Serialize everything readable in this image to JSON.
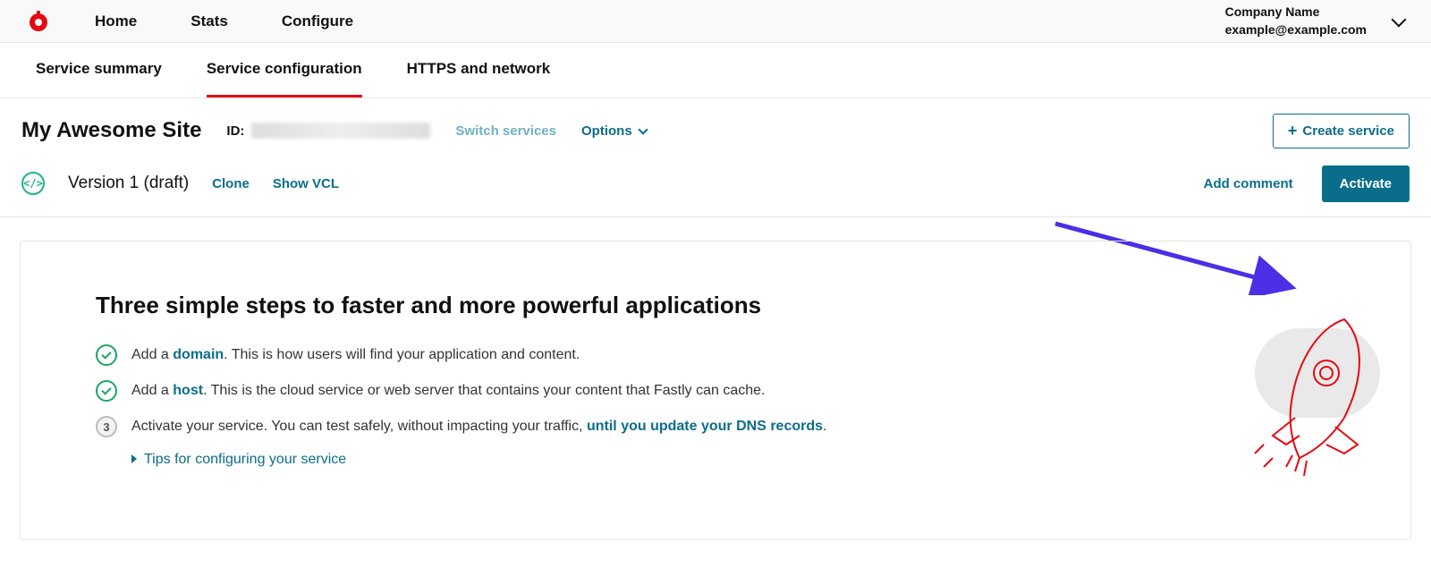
{
  "topnav": {
    "items": [
      "Home",
      "Stats",
      "Configure"
    ],
    "account": {
      "company": "Company Name",
      "email": "example@example.com"
    }
  },
  "subtabs": {
    "items": [
      "Service summary",
      "Service configuration",
      "HTTPS and network"
    ],
    "active_index": 1
  },
  "service": {
    "title": "My Awesome Site",
    "id_label": "ID:",
    "switch_label": "Switch services",
    "options_label": "Options",
    "create_label": "Create service"
  },
  "version": {
    "text": "Version 1 (draft)",
    "clone_label": "Clone",
    "show_vcl_label": "Show VCL",
    "add_comment_label": "Add comment",
    "activate_label": "Activate"
  },
  "panel": {
    "heading": "Three simple steps to faster and more powerful applications",
    "steps": [
      {
        "done": true,
        "pre": "Add a ",
        "link": "domain",
        "post": ". This is how users will find your application and content."
      },
      {
        "done": true,
        "pre": "Add a ",
        "link": "host",
        "post": ". This is the cloud service or web server that contains your content that Fastly can cache."
      },
      {
        "done": false,
        "number": "3",
        "pre": "Activate your service. You can test safely, without impacting your traffic, ",
        "link": "until you update your DNS records",
        "post": "."
      }
    ],
    "tips_label": "Tips for configuring your service"
  }
}
